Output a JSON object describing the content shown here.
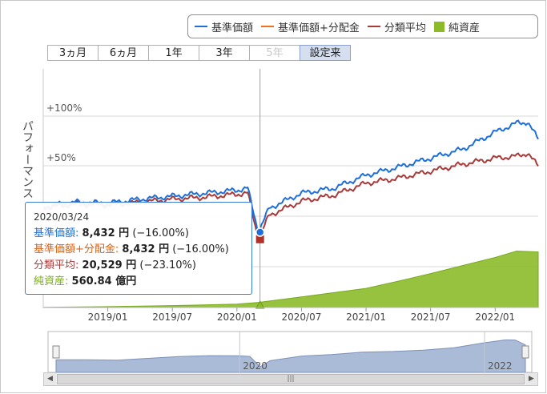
{
  "legend": {
    "items": [
      {
        "label": "基準価額",
        "color": "#1e6fd9",
        "kind": "line"
      },
      {
        "label": "基準価額+分配金",
        "color": "#f07020",
        "kind": "line"
      },
      {
        "label": "分類平均",
        "color": "#a83a3a",
        "kind": "line"
      },
      {
        "label": "純資産",
        "color": "#8cbb2a",
        "kind": "square"
      }
    ]
  },
  "range_buttons": [
    {
      "label": "3ヵ月",
      "state": "normal"
    },
    {
      "label": "6ヵ月",
      "state": "normal"
    },
    {
      "label": "1年",
      "state": "normal"
    },
    {
      "label": "3年",
      "state": "normal"
    },
    {
      "label": "5年",
      "state": "disabled"
    },
    {
      "label": "設定来",
      "state": "selected"
    }
  ],
  "y_axis_label": "パフォーマンス",
  "tooltip": {
    "date": "2020/03/24",
    "rows": [
      {
        "label": "基準価額:",
        "value": "8,432 円",
        "extra": "(−16.00%)",
        "color": "#1e6fd9"
      },
      {
        "label": "基準価額+分配金:",
        "value": "8,432 円",
        "extra": "(−16.00%)",
        "color": "#e06010"
      },
      {
        "label": "分類平均:",
        "value": "20,529 円",
        "extra": "(−23.10%)",
        "color": "#a83a3a"
      },
      {
        "label": "純資産:",
        "value": "560.84 億円",
        "extra": "",
        "color": "#7aaa20"
      }
    ]
  },
  "chart_data": {
    "type": "line",
    "y_ticks": [
      "+100%",
      "+50%"
    ],
    "x_ticks": [
      "2019/01",
      "2019/07",
      "2020/01",
      "2020/07",
      "2021/01",
      "2021/07",
      "2022/01"
    ],
    "navigator_labels": [
      "2020",
      "2022"
    ],
    "crosshair_date": "2020/03/24",
    "series": [
      {
        "name": "基準価額",
        "color": "#1e6fd9",
        "x": [
          "2018/07",
          "2018/10",
          "2019/01",
          "2019/04",
          "2019/07",
          "2019/10",
          "2020/01",
          "2020/02",
          "2020/03",
          "2020/04",
          "2020/07",
          "2020/10",
          "2021/01",
          "2021/04",
          "2021/07",
          "2021/10",
          "2022/01",
          "2022/03",
          "2022/04",
          "2022/05"
        ],
        "y": [
          10,
          14,
          13,
          17,
          20,
          23,
          26,
          28,
          -16,
          8,
          23,
          28,
          41,
          49,
          58,
          67,
          84,
          93,
          94,
          77
        ]
      },
      {
        "name": "分類平均",
        "color": "#a83a3a",
        "x": [
          "2018/07",
          "2018/10",
          "2019/01",
          "2019/04",
          "2019/07",
          "2019/10",
          "2020/01",
          "2020/02",
          "2020/03",
          "2020/04",
          "2020/07",
          "2020/10",
          "2021/01",
          "2021/04",
          "2021/07",
          "2021/10",
          "2022/01",
          "2022/03",
          "2022/04",
          "2022/05"
        ],
        "y": [
          8,
          12,
          11,
          14,
          17,
          19,
          22,
          23,
          -23,
          1,
          15,
          21,
          33,
          38,
          45,
          52,
          58,
          60,
          63,
          50
        ]
      },
      {
        "name": "純資産",
        "color": "#8cbb2a",
        "x": [
          "2018/07",
          "2019/01",
          "2019/07",
          "2020/01",
          "2020/03",
          "2020/07",
          "2021/01",
          "2021/04",
          "2021/07",
          "2021/10",
          "2022/01",
          "2022/03",
          "2022/05"
        ],
        "y": [
          5,
          20,
          45,
          80,
          120,
          250,
          450,
          620,
          800,
          990,
          1180,
          1330,
          1310
        ]
      }
    ]
  }
}
